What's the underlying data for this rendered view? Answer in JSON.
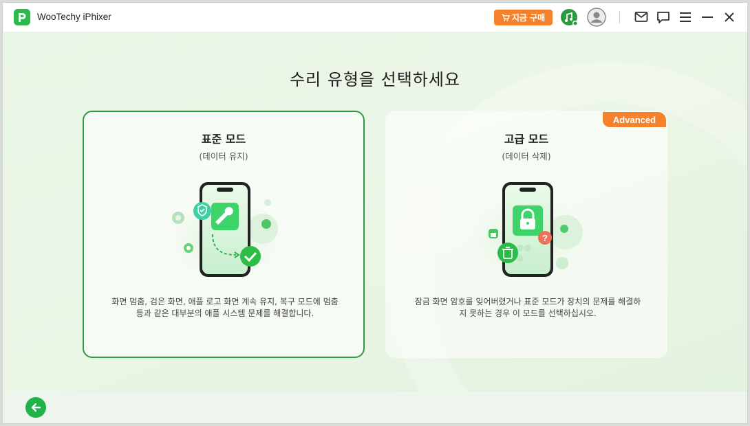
{
  "app": {
    "title": "WooTechy iPhixer"
  },
  "titlebar": {
    "buy_label": "지금 구매",
    "icons": [
      "music-badge-icon",
      "user-avatar-icon",
      "mail-icon",
      "chat-icon",
      "menu-icon",
      "minimize-icon",
      "close-icon"
    ]
  },
  "main": {
    "title": "수리 유형을 선택하세요",
    "cards": [
      {
        "title": "표준 모드",
        "subtitle": "(데이터 유지)",
        "description": "화면 멈춤, 검은 화면, 애플 로고 화면 계속 유지, 복구 모드에 멈춤 등과 같은 대부분의 애플 시스템 문제를 해결합니다.",
        "selected": true,
        "icon": "phone-wrench-illustration"
      },
      {
        "title": "고급 모드",
        "subtitle": "(데이터 삭제)",
        "badge": "Advanced",
        "description": "잠금 화면 암호를 잊어버렸거나 표준 모드가 장치의 문제를 해결하지 못하는 경우 이 모드를 선택하십시오.",
        "selected": false,
        "icon": "phone-lock-illustration"
      }
    ]
  },
  "colors": {
    "accent_green": "#2e9b43",
    "button_green": "#1fb34a",
    "badge_orange": "#f5822a"
  }
}
